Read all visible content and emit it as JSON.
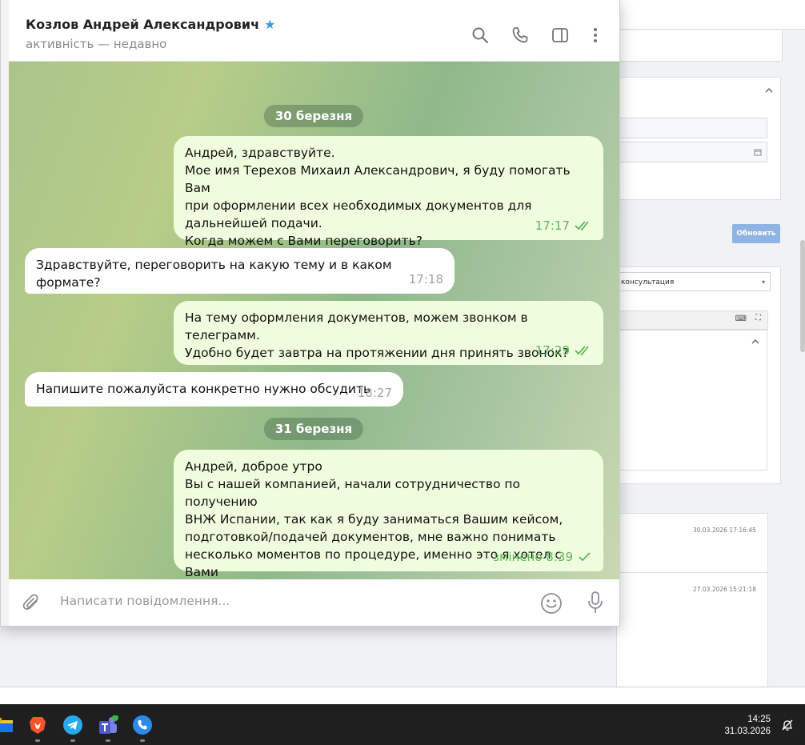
{
  "chat": {
    "name": "Козлов Андрей Александрович",
    "verified_icon": "star-icon",
    "status": "активність — недавно",
    "header_icons": [
      "search-icon",
      "phone-icon",
      "sidebar-toggle-icon",
      "more-vertical-icon"
    ]
  },
  "messages": {
    "date1": "30 березня",
    "m1": {
      "text": "Андрей, здравствуйте.\nМое имя Терехов Михаил Александрович, я буду помогать Вам\nпри оформлении всех необходимых документов для\nдальнейшей подачи.\nКогда можем с Вами переговорить?",
      "time": "17:17"
    },
    "m2": {
      "text": "Здравствуйте, переговорить на какую тему и в каком формате?",
      "time": "17:18"
    },
    "m3": {
      "text": "На тему оформления документов, можем звонком в телеграмм.\nУдобно будет завтра на протяжении дня принять звонок?",
      "time": "17:29"
    },
    "m4": {
      "text": "Напишите пожалуйста конкретно нужно обсудить",
      "time": "18:27"
    },
    "date2": "31 березня",
    "m5": {
      "text": "Андрей, доброе утро\nВы с нашей компанией, начали сотрудничество по получению\nВНЖ Испании, так как я буду заниматься Вашим кейсом,\nподготовкой/подачей документов, мне важно понимать\nнесколько моментов по процедуре, именно это я хотел с Вами\nобсудить",
      "time": "змінено 8:39"
    }
  },
  "composer": {
    "placeholder": "Написати повідомлення...",
    "icons": [
      "attach-icon",
      "emoji-icon",
      "microphone-icon"
    ]
  },
  "background_app": {
    "update_button": "Обновить",
    "select_value": "консультация",
    "timestamp1": "30.03.2026 17:16:45",
    "timestamp2": "27.03.2026 15:21:18"
  },
  "taskbar": {
    "time": "14:25",
    "date": "31.03.2026",
    "apps": [
      "file-explorer-icon",
      "brave-icon",
      "telegram-icon",
      "teams-icon",
      "viber-icon"
    ]
  },
  "colors": {
    "outgoing_bubble": "#effdde",
    "incoming_bubble": "#ffffff",
    "read_check": "#5db75a",
    "accent": "#3a9ae0"
  }
}
